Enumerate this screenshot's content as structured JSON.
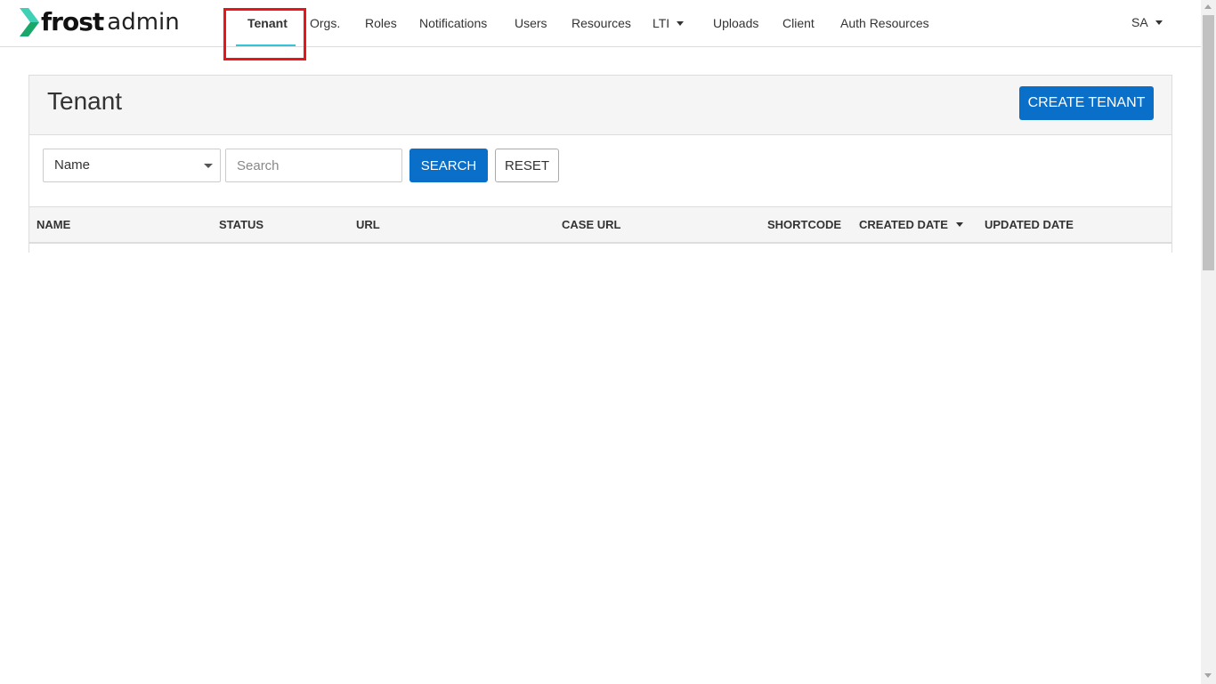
{
  "logo": {
    "brand": "frost",
    "suffix": "admin",
    "icon": "chevron-logo-icon",
    "colors": {
      "chevron_top": "#3fd0b5",
      "chevron_bottom": "#1aa86a"
    }
  },
  "nav": {
    "items": [
      {
        "label": "Tenant",
        "active": true
      },
      {
        "label": "Orgs."
      },
      {
        "label": "Roles"
      },
      {
        "label": "Notifications"
      },
      {
        "label": "Users"
      },
      {
        "label": "Resources"
      },
      {
        "label": "LTI",
        "dropdown": true
      },
      {
        "label": "Uploads"
      },
      {
        "label": "Client"
      },
      {
        "label": "Auth Resources"
      }
    ],
    "user": {
      "label": "SA",
      "dropdown": true
    },
    "active_underline_color": "#35c3d6",
    "highlight_color": "#e8151b"
  },
  "page": {
    "title": "Tenant",
    "create_button": "CREATE TENANT"
  },
  "filter": {
    "field_select": "Name",
    "search_placeholder": "Search",
    "search_value": "",
    "search_button": "SEARCH",
    "reset_button": "RESET"
  },
  "table": {
    "columns": [
      {
        "label": "NAME"
      },
      {
        "label": "STATUS"
      },
      {
        "label": "URL"
      },
      {
        "label": "CASE URL"
      },
      {
        "label": "SHORTCODE"
      },
      {
        "label": "CREATED DATE",
        "sorted": "desc"
      },
      {
        "label": "UPDATED DATE"
      }
    ],
    "rows": []
  },
  "colors": {
    "primary": "#0a6fc9",
    "panel_bg": "#f5f5f5",
    "border": "#dddddd"
  }
}
